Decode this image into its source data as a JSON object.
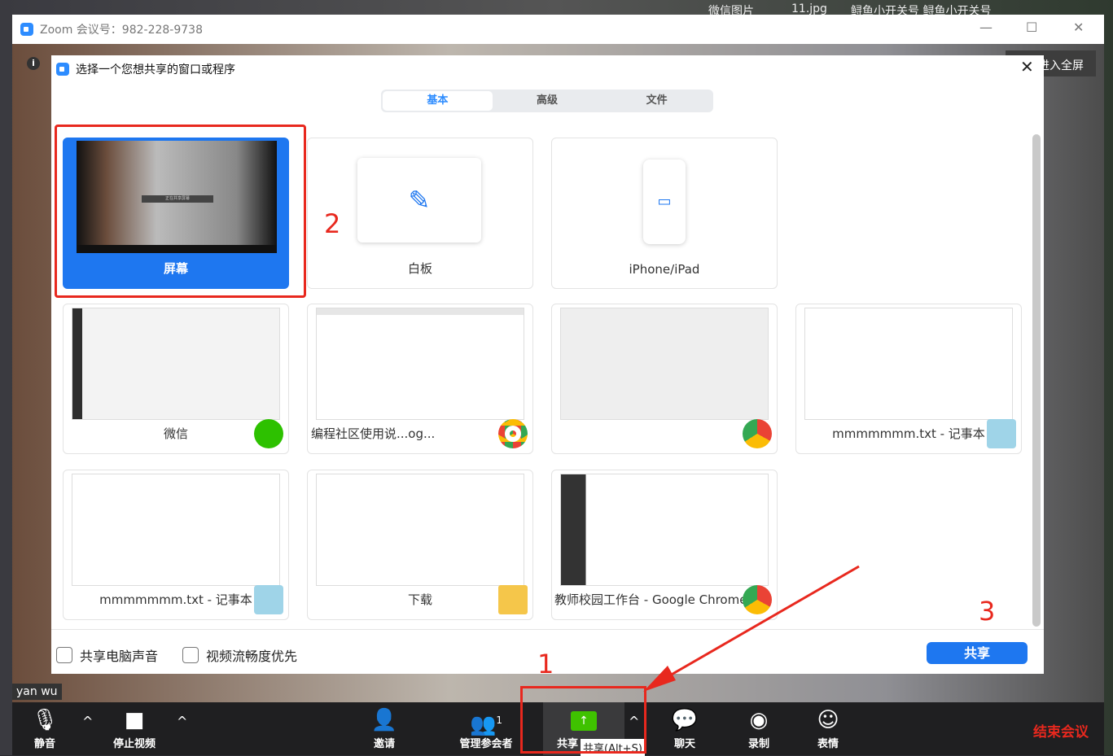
{
  "desktop": {
    "labels": [
      "微信图片",
      "11.jpg",
      "鲟鱼小开关号 鲟鱼小开关号"
    ]
  },
  "window": {
    "title": "Zoom 会议号：982-228-9738",
    "fullscreen": "进入全屏",
    "participant_name": "yan wu"
  },
  "dialog": {
    "title": "选择一个您想共享的窗口或程序",
    "tabs": [
      {
        "label": "基本",
        "active": true
      },
      {
        "label": "高级",
        "active": false
      },
      {
        "label": "文件",
        "active": false
      }
    ],
    "items": [
      {
        "label": "屏幕",
        "selected": true,
        "screen_caption": "正在共享屏幕",
        "icon": "monitor"
      },
      {
        "label": "白板",
        "icon": "pen-icon"
      },
      {
        "label": "iPhone/iPad",
        "icon": "airplay-icon"
      },
      {
        "label": "微信",
        "icon": "wechat-icon"
      },
      {
        "label": "编程社区使用说...og...",
        "icon": "chrome-icon"
      },
      {
        "label": "",
        "icon": "chrome-icon"
      },
      {
        "label": "mmmmmmm.txt - 记事本",
        "icon": "notepad-icon"
      },
      {
        "label": "mmmmmmm.txt - 记事本",
        "icon": "notepad-icon"
      },
      {
        "label": "下载",
        "icon": "folder-download-icon"
      },
      {
        "label": "教师校园工作台 - Google Chrome",
        "icon": "chrome-icon"
      }
    ],
    "options": {
      "share_audio": "共享电脑声音",
      "optimize_video": "视频流畅度优先"
    },
    "share_button": "共享"
  },
  "toolbar": {
    "mute": "静音",
    "stop_video": "停止视频",
    "invite": "邀请",
    "participants": "管理参会者",
    "participant_count": "1",
    "share": "共享",
    "share_tooltip": "共享(Alt+S)",
    "chat": "聊天",
    "record": "录制",
    "reactions": "表情",
    "end": "结束会议"
  },
  "annotations": {
    "step1": "1",
    "step2": "2",
    "step3": "3"
  },
  "colors": {
    "accent": "#1e77f0",
    "share_green": "#3fc200",
    "end_red": "#e8281e"
  }
}
